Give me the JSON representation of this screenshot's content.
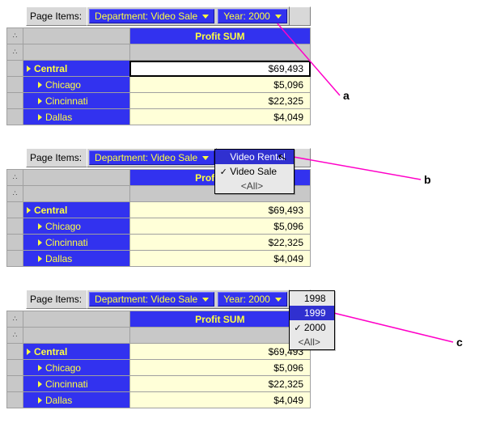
{
  "labels": {
    "page_items": "Page Items:",
    "all_option": "<All>"
  },
  "colhdr": "Profit SUM",
  "rows": [
    {
      "label": "Central",
      "level": "parent",
      "value": "$69,493"
    },
    {
      "label": "Chicago",
      "level": "child",
      "value": "$5,096"
    },
    {
      "label": "Cincinnati",
      "level": "child",
      "value": "$22,325"
    },
    {
      "label": "Dallas",
      "level": "child",
      "value": "$4,049"
    }
  ],
  "panels": {
    "a": {
      "dept": {
        "caption": "Department: Video Sale"
      },
      "year": {
        "caption": "Year: 2000"
      },
      "selected_cell_row": 0
    },
    "b": {
      "dept": {
        "caption": "Department: Video Sale"
      },
      "menu": {
        "items": [
          {
            "text": "Video Rental",
            "checked": false,
            "selected": true
          },
          {
            "text": "Video Sale",
            "checked": true,
            "selected": false
          },
          {
            "text": "<All>",
            "checked": false,
            "selected": false,
            "all": true
          }
        ]
      }
    },
    "c": {
      "dept": {
        "caption": "Department: Video Sale"
      },
      "year": {
        "caption": "Year: 2000"
      },
      "menu": {
        "items": [
          {
            "text": "1998",
            "checked": false,
            "selected": false
          },
          {
            "text": "1999",
            "checked": false,
            "selected": true
          },
          {
            "text": "2000",
            "checked": true,
            "selected": false
          },
          {
            "text": "<All>",
            "checked": false,
            "selected": false,
            "all": true
          }
        ]
      }
    }
  },
  "annotations": {
    "a": "a",
    "b": "b",
    "c": "c"
  },
  "colors": {
    "line": "#ff00c8"
  }
}
